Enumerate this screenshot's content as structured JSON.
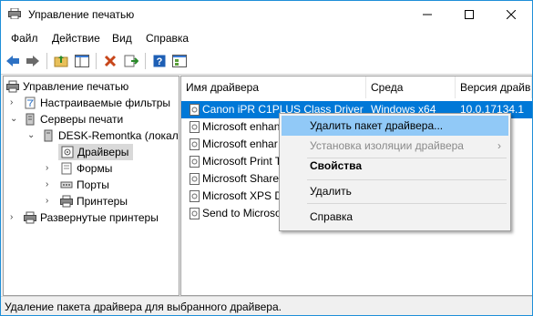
{
  "window": {
    "title": "Управление печатью",
    "buttons": [
      "minimize-icon",
      "maximize-icon",
      "close-icon"
    ]
  },
  "menu": [
    "Файл",
    "Действие",
    "Вид",
    "Справка"
  ],
  "toolbar": [
    "back-icon",
    "forward-icon",
    "up-folder-icon",
    "show-hide-tree-icon",
    "delete-icon",
    "export-icon",
    "help-icon",
    "properties-icon"
  ],
  "tree": {
    "root": "Управление печатью",
    "filters": "Настраиваемые фильтры",
    "servers": "Серверы печати",
    "server_name": "DESK-Remontka (локал",
    "drivers": "Драйверы",
    "forms": "Формы",
    "ports": "Порты",
    "printers": "Принтеры",
    "deployed": "Развернутые принтеры"
  },
  "list": {
    "columns": [
      "Имя драйвера",
      "Среда",
      "Версия драйв"
    ],
    "rows": [
      {
        "name": "Canon iPR C1PLUS Class Driver",
        "env": "Windows x64",
        "ver": "10.0.17134.1"
      },
      {
        "name": "Microsoft enhan",
        "env": "",
        "ver": ""
      },
      {
        "name": "Microsoft enhar",
        "env": "",
        "ver": ""
      },
      {
        "name": "Microsoft Print T",
        "env": "",
        "ver": ""
      },
      {
        "name": "Microsoft Sharec",
        "env": "",
        "ver": ""
      },
      {
        "name": "Microsoft XPS D",
        "env": "",
        "ver": ""
      },
      {
        "name": "Send to Microso",
        "env": "",
        "ver": "000"
      }
    ]
  },
  "context_menu": {
    "delete_package": "Удалить пакет драйвера...",
    "isolation": "Установка изоляции драйвера",
    "properties": "Свойства",
    "delete": "Удалить",
    "help": "Справка"
  },
  "status": "Удаление пакета драйвера для выбранного драйвера.",
  "colors": {
    "selection": "#0078d7",
    "menu_highlight": "#91c9f7",
    "window_border": "#1e8fd8"
  }
}
